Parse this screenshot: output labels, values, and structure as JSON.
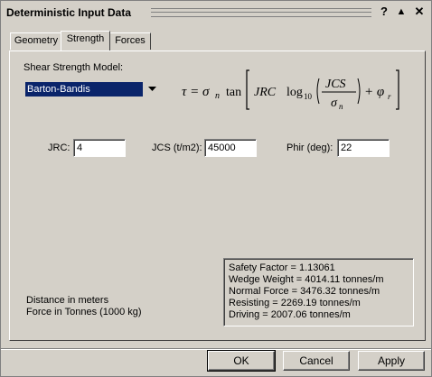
{
  "window": {
    "title": "Deterministic Input Data",
    "help_label": "?",
    "minimize_label": "▲",
    "close_label": "✕"
  },
  "tabs": [
    {
      "label": "Geometry",
      "active": false
    },
    {
      "label": "Strength",
      "active": true
    },
    {
      "label": "Forces",
      "active": false
    }
  ],
  "strength": {
    "model_label": "Shear Strength Model:",
    "model_value": "Barton-Bandis",
    "formula": {
      "lhs": "τ = σ",
      "lhs_sub": "n",
      "tan": "tan",
      "jrc": "JRC",
      "log": "log",
      "log_sub": "10",
      "num": "JCS",
      "den": "σ",
      "den_sub": "n",
      "plus": "+ φ",
      "phi_sub": "r"
    },
    "jrc_label": "JRC:",
    "jrc_value": "4",
    "jcs_label": "JCS (t/m2):",
    "jcs_value": "45000",
    "phir_label": "Phir (deg):",
    "phir_value": "22"
  },
  "units": {
    "distance": "Distance in meters",
    "force": "Force in Tonnes (1000 kg)"
  },
  "results": [
    "Safety Factor = 1.13061",
    "Wedge Weight = 4014.11 tonnes/m",
    "Normal Force = 3476.32 tonnes/m",
    "Resisting = 2269.19 tonnes/m",
    "Driving = 2007.06 tonnes/m"
  ],
  "buttons": {
    "ok": "OK",
    "cancel": "Cancel",
    "apply": "Apply"
  }
}
